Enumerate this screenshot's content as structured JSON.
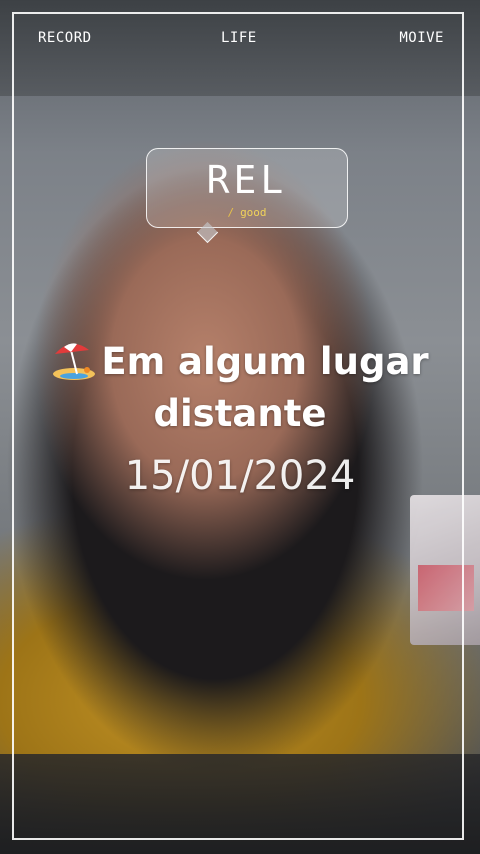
{
  "top_bar": {
    "left": "RECORD",
    "middle": "LIFE",
    "right": "MOIVE"
  },
  "bubble": {
    "title": "REL",
    "slash": "/",
    "subtitle": "good"
  },
  "caption": {
    "text_line1": "Em algum lugar",
    "text_line2": "distante",
    "icon": "beach-umbrella-icon"
  },
  "date": "15/01/2024",
  "colors": {
    "frame": "#ffffff",
    "subtitle": "#f1d35a"
  }
}
